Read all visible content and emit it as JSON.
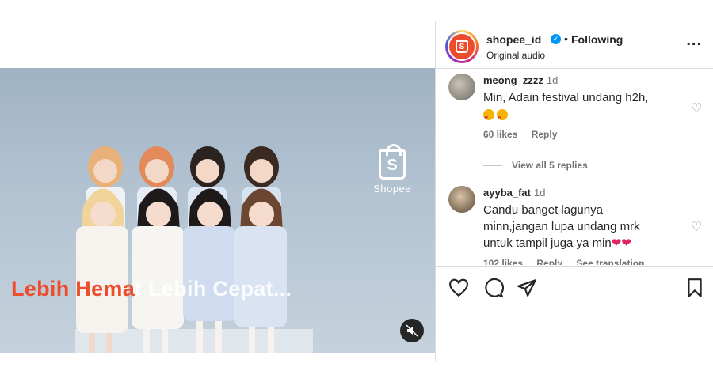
{
  "header": {
    "username": "shopee_id",
    "separator": "•",
    "follow_status": "Following",
    "audio": "Original audio",
    "more": "...",
    "avatar_letter": "S"
  },
  "media": {
    "logo_letter": "S",
    "logo_text": "Shopee",
    "caption_highlight": "Lebih Hema",
    "caption_rest": "t Lebih Cepat...",
    "mute_icon": "muted-speaker-icon"
  },
  "comments": [
    {
      "user": "meong_zzzz",
      "time": "1d",
      "text": "Min, Adain festival undang h2h,",
      "likes": "60 likes",
      "reply": "Reply",
      "view_replies": "View all 5 replies"
    },
    {
      "user": "ayyba_fat",
      "time": "1d",
      "text_lines": [
        "Candu banget lagunya",
        "minn,jangan lupa undang mrk",
        "untuk tampil juga ya min"
      ],
      "hearts": "❤❤",
      "likes": "102 likes",
      "reply": "Reply",
      "translation": "See translation"
    }
  ],
  "colors": {
    "brand": "#ee4d2d",
    "verified": "#0095f6",
    "muted_text": "#737373"
  }
}
